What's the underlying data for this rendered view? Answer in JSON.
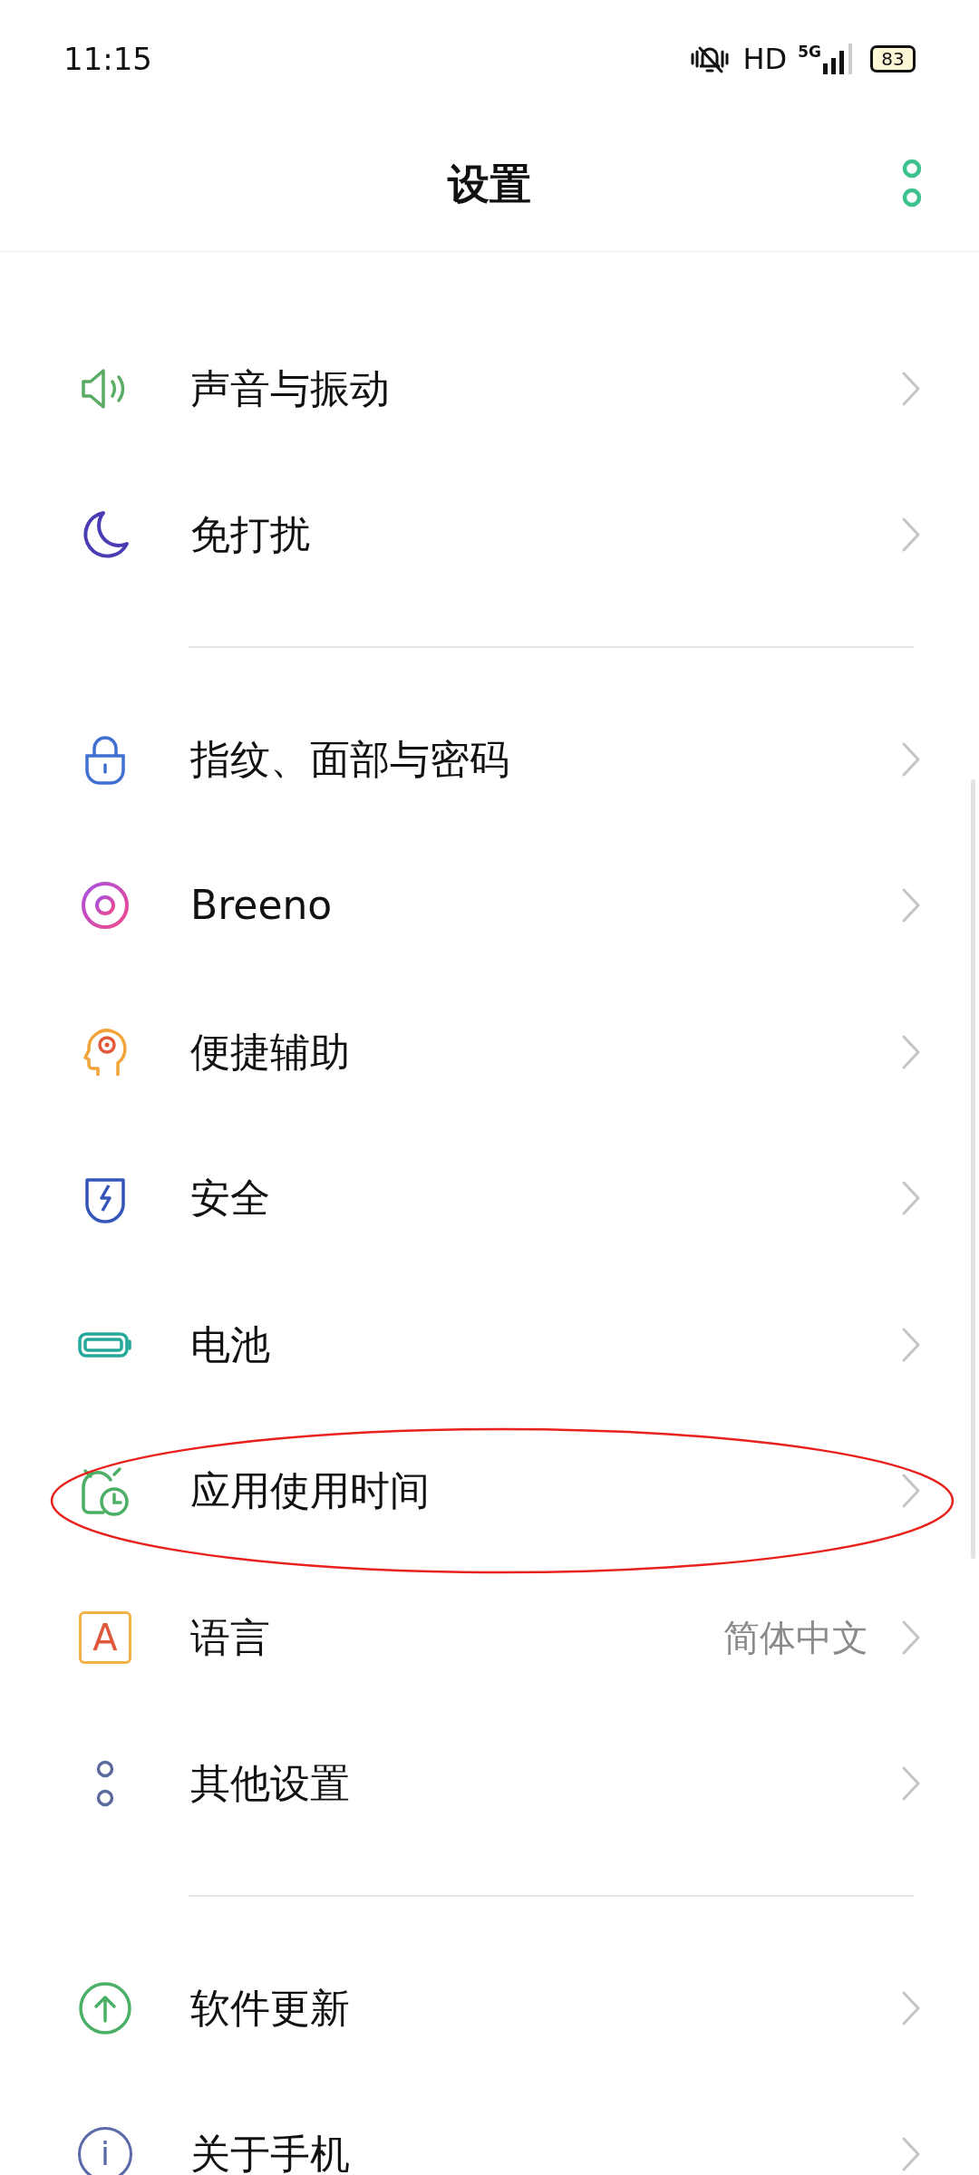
{
  "status_bar": {
    "time": "11:15",
    "hd": "HD",
    "network": "5G",
    "battery": "83"
  },
  "header": {
    "title": "设置"
  },
  "sections": [
    {
      "items": [
        {
          "kind": "speaker",
          "label": "声音与振动"
        },
        {
          "kind": "moon",
          "label": "免打扰"
        }
      ]
    },
    {
      "items": [
        {
          "kind": "lock",
          "label": "指纹、面部与密码"
        },
        {
          "kind": "ring",
          "label": "Breeno"
        },
        {
          "kind": "head",
          "label": "便捷辅助"
        },
        {
          "kind": "shield",
          "label": "安全"
        },
        {
          "kind": "battery",
          "label": "电池"
        },
        {
          "kind": "clock",
          "label": "应用使用时间",
          "annotated": true
        },
        {
          "kind": "letter",
          "label": "语言",
          "value": "简体中文",
          "glyph": "A"
        },
        {
          "kind": "dots",
          "label": "其他设置"
        }
      ]
    },
    {
      "items": [
        {
          "kind": "update",
          "label": "软件更新"
        },
        {
          "kind": "info",
          "label": "关于手机",
          "glyph": "i"
        }
      ]
    }
  ]
}
